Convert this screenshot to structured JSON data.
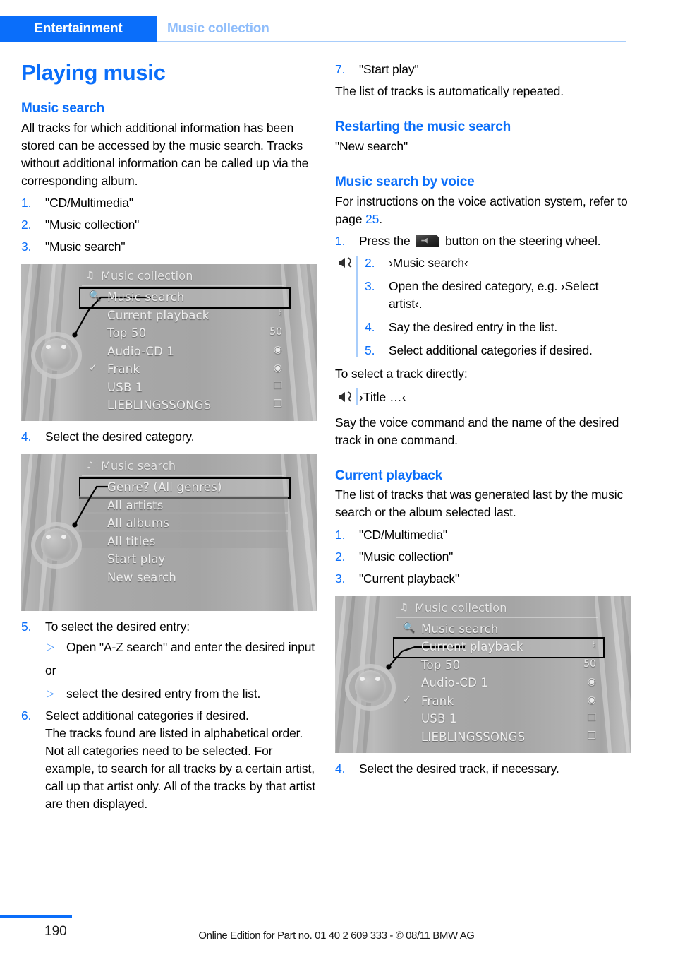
{
  "header": {
    "tab": "Entertainment",
    "breadcrumb": "Music collection"
  },
  "left": {
    "title": "Playing music",
    "music_search": {
      "heading": "Music search",
      "intro": "All tracks for which additional information has been stored can be accessed by the music search. Tracks without additional information can be called up via the corresponding album.",
      "steps": [
        {
          "num": "1.",
          "text": "\"CD/Multimedia\""
        },
        {
          "num": "2.",
          "text": "\"Music collection\""
        },
        {
          "num": "3.",
          "text": "\"Music search\""
        }
      ],
      "step4": {
        "num": "4.",
        "text": "Select the desired category."
      },
      "step5": {
        "num": "5.",
        "text": "To select the desired entry:"
      },
      "bullet1": "Open \"A-Z search\" and enter the desired input",
      "or": "or",
      "bullet2": "select the desired entry from the list.",
      "step6": {
        "num": "6.",
        "line1": "Select additional categories if desired.",
        "line2": "The tracks found are listed in alphabetical order.",
        "line3": "Not all categories need to be selected. For example, to search for all tracks by a certain artist, call up that artist only. All of the tracks by that artist are then displayed."
      }
    },
    "figure1": {
      "title": "Music collection",
      "title_icon": "music-note-icon",
      "rows": [
        {
          "label": "Music search",
          "lead_icon": "magnifier-icon",
          "row_icon": "",
          "state": "selected"
        },
        {
          "label": "Current playback",
          "lead_icon": "",
          "row_icon": "playlist-note-icon",
          "state": "normal"
        },
        {
          "label": "Top 50",
          "lead_icon": "",
          "row_icon": "50",
          "state": "normal"
        },
        {
          "label": "Audio-CD 1",
          "lead_icon": "",
          "row_icon": "disc-icon",
          "state": "normal"
        },
        {
          "label": "Frank",
          "lead_icon": "check-icon",
          "row_icon": "disc-icon",
          "state": "normal"
        },
        {
          "label": "USB 1",
          "lead_icon": "",
          "row_icon": "folder-icon",
          "state": "normal"
        },
        {
          "label": "LIEBLINGSSONGS",
          "lead_icon": "",
          "row_icon": "folder-icon",
          "state": "normal"
        }
      ]
    },
    "figure2": {
      "title": "Music search",
      "title_icon": "music-search-icon",
      "rows": [
        {
          "label": "Genre? (All genres)",
          "lead_icon": "",
          "row_icon": "",
          "state": "selected"
        },
        {
          "label": "All artists",
          "lead_icon": "",
          "row_icon": "",
          "state": "band"
        },
        {
          "label": "All albums",
          "lead_icon": "",
          "row_icon": "",
          "state": "band"
        },
        {
          "label": "All titles",
          "lead_icon": "",
          "row_icon": "",
          "state": "band"
        },
        {
          "label": "Start play",
          "lead_icon": "",
          "row_icon": "",
          "state": "normal"
        },
        {
          "label": "New search",
          "lead_icon": "",
          "row_icon": "",
          "state": "normal"
        }
      ]
    }
  },
  "right": {
    "step7": {
      "num": "7.",
      "text": "\"Start play\""
    },
    "after_step7": "The list of tracks is automatically repeated.",
    "restarting": {
      "heading": "Restarting the music search",
      "text": "\"New search\""
    },
    "voice": {
      "heading": "Music search by voice",
      "intro_a": "For instructions on the voice activation system, refer to page ",
      "intro_page": "25",
      "intro_b": ".",
      "step1_num": "1.",
      "step1_a": "Press the ",
      "step1_b": " button on the steering wheel.",
      "button_icon": "steering-wheel-voice-button-icon",
      "voice_icon": "voice-command-icon",
      "steps": [
        {
          "num": "2.",
          "text": "›Music search‹"
        },
        {
          "num": "3.",
          "text": "Open the desired category, e.g. ›Select artist‹."
        },
        {
          "num": "4.",
          "text": "Say the desired entry in the list."
        },
        {
          "num": "5.",
          "text": "Select additional categories if desired."
        }
      ],
      "direct_intro": "To select a track directly:",
      "direct_command": "›Title …‹",
      "direct_note": "Say the voice command and the name of the desired track in one command."
    },
    "current_playback": {
      "heading": "Current playback",
      "intro": "The list of tracks that was generated last by the music search or the album selected last.",
      "steps": [
        {
          "num": "1.",
          "text": "\"CD/Multimedia\""
        },
        {
          "num": "2.",
          "text": "\"Music collection\""
        },
        {
          "num": "3.",
          "text": "\"Current playback\""
        }
      ],
      "step4": {
        "num": "4.",
        "text": "Select the desired track, if necessary."
      }
    },
    "figure3": {
      "title": "Music collection",
      "title_icon": "music-note-icon",
      "rows": [
        {
          "label": "Music search",
          "lead_icon": "magnifier-icon",
          "row_icon": "",
          "state": "normal"
        },
        {
          "label": "Current playback",
          "lead_icon": "",
          "row_icon": "playlist-note-icon",
          "state": "selected"
        },
        {
          "label": "Top 50",
          "lead_icon": "",
          "row_icon": "50",
          "state": "normal"
        },
        {
          "label": "Audio-CD 1",
          "lead_icon": "",
          "row_icon": "disc-icon",
          "state": "normal"
        },
        {
          "label": "Frank",
          "lead_icon": "check-icon",
          "row_icon": "disc-icon",
          "state": "normal"
        },
        {
          "label": "USB 1",
          "lead_icon": "",
          "row_icon": "folder-icon",
          "state": "normal"
        },
        {
          "label": "LIEBLINGSSONGS",
          "lead_icon": "",
          "row_icon": "folder-icon",
          "state": "normal"
        }
      ]
    }
  },
  "footer": {
    "page": "190",
    "note": "Online Edition for Part no. 01 40 2 609 333 - © 08/11 BMW AG"
  },
  "colors": {
    "accent_blue": "#0a6efa",
    "light_blue": "#8fbdfb",
    "rule_blue": "#a8cdfb"
  }
}
